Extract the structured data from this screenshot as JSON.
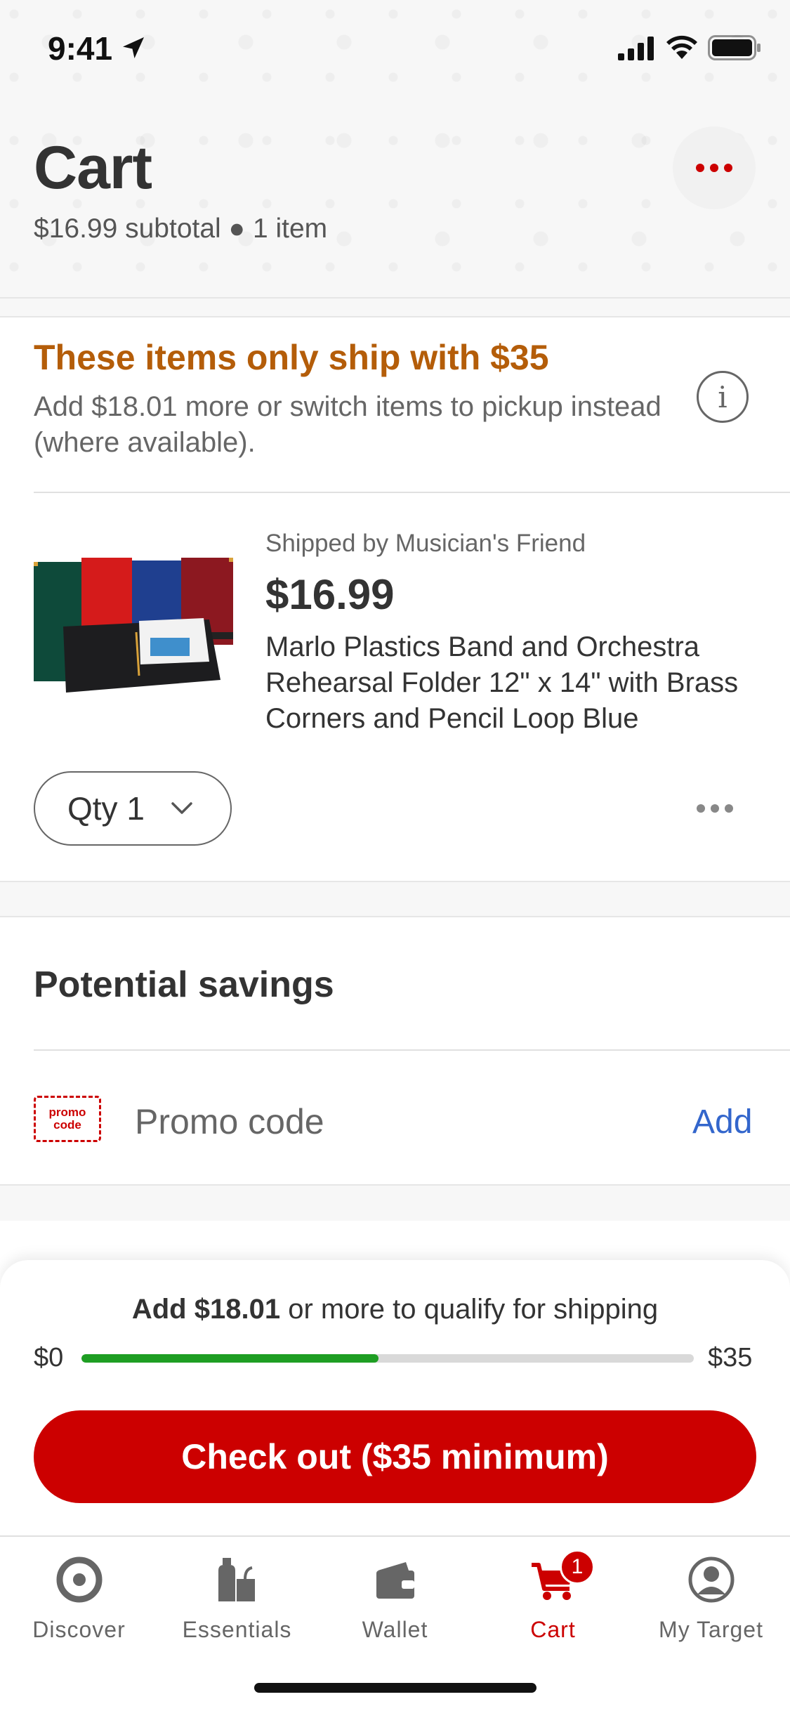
{
  "status_bar": {
    "time": "9:41"
  },
  "header": {
    "title": "Cart",
    "subtitle": "$16.99 subtotal ● 1 item"
  },
  "shipping_notice": {
    "title": "These items only ship with $35",
    "description": "Add $18.01 more or switch items to pickup instead (where available)."
  },
  "cart_item": {
    "shipped_by": "Shipped by Musician's Friend",
    "price": "$16.99",
    "name": "Marlo Plastics Band and Orchestra Rehearsal Folder 12\" x 14\" with Brass Corners and Pencil Loop Blue",
    "qty_label": "Qty 1"
  },
  "savings": {
    "title": "Potential savings",
    "promo_icon_line1": "promo",
    "promo_icon_line2": "code",
    "promo_label": "Promo code",
    "promo_action": "Add"
  },
  "checkout": {
    "qualify_amount": "Add $18.01",
    "qualify_rest": " or more to qualify for shipping",
    "progress_start": "$0",
    "progress_end": "$35",
    "progress_fraction": 0.485,
    "button_label": "Check out ($35 minimum)"
  },
  "tab_bar": {
    "tabs": [
      {
        "label": "Discover",
        "icon": "target-icon"
      },
      {
        "label": "Essentials",
        "icon": "essentials-icon"
      },
      {
        "label": "Wallet",
        "icon": "wallet-icon"
      },
      {
        "label": "Cart",
        "icon": "cart-icon",
        "badge": "1",
        "active": true
      },
      {
        "label": "My Target",
        "icon": "account-icon"
      }
    ]
  },
  "colors": {
    "brand_red": "#cc0000",
    "warning_orange": "#b45d09",
    "link_blue": "#3366cc",
    "progress_green": "#1e9e23"
  }
}
